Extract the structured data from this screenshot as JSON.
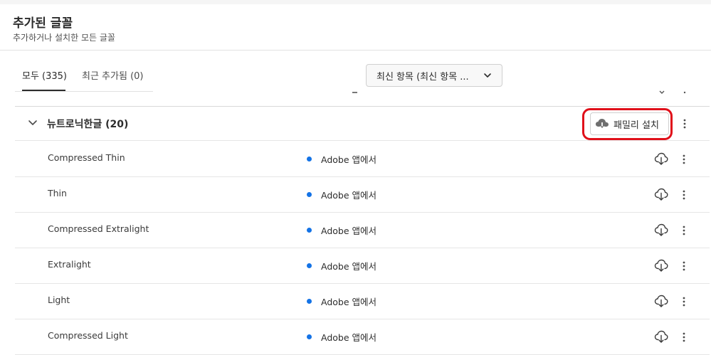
{
  "header": {
    "title": "추가된 글꼴",
    "subtitle": "추가하거나 설치한 모든 글꼴"
  },
  "tabs": [
    {
      "label": "모두 (335)",
      "active": true
    },
    {
      "label": "최근 추가됨 (0)",
      "active": false
    }
  ],
  "sort": {
    "selected": "최신 항목 (최신 항목 ..."
  },
  "family": {
    "name": "뉴트로닉한글 (20)",
    "install_label": "패밀리 설치"
  },
  "fonts": [
    {
      "name": "Compressed Thin",
      "status": "Adobe 앱에서"
    },
    {
      "name": "Thin",
      "status": "Adobe 앱에서"
    },
    {
      "name": "Compressed Extralight",
      "status": "Adobe 앱에서"
    },
    {
      "name": "Extralight",
      "status": "Adobe 앱에서"
    },
    {
      "name": "Light",
      "status": "Adobe 앱에서"
    },
    {
      "name": "Compressed Light",
      "status": "Adobe 앱에서"
    }
  ],
  "colors": {
    "accent": "#1473e6",
    "highlight": "#e0101a"
  },
  "icons": {
    "sort": "chevron-down-icon",
    "family_toggle": "chevron-down-icon",
    "install": "cloud-download-icon",
    "row_action": "cloud-download-icon",
    "menu": "more-vertical-icon"
  }
}
